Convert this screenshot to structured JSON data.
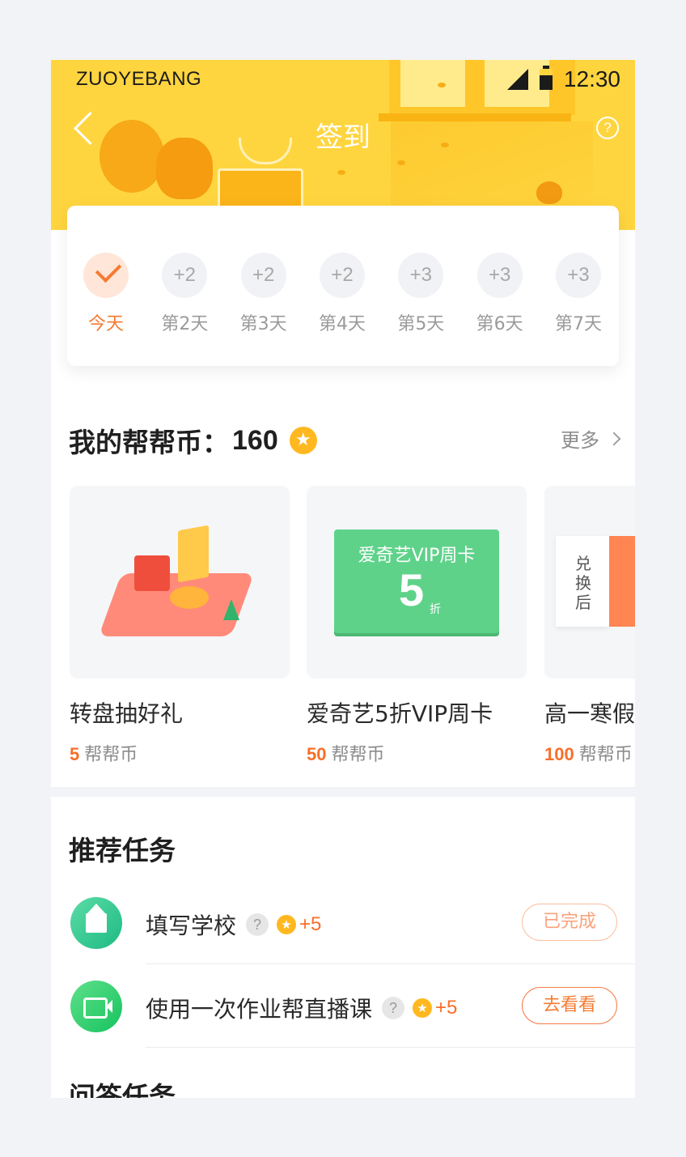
{
  "status_bar": {
    "carrier": "ZUOYEBANG",
    "time": "12:30"
  },
  "nav": {
    "title": "签到"
  },
  "signin": {
    "days": [
      {
        "circle": "",
        "label": "今天",
        "checked": true
      },
      {
        "circle": "+2",
        "label": "第2天"
      },
      {
        "circle": "+2",
        "label": "第3天"
      },
      {
        "circle": "+2",
        "label": "第4天"
      },
      {
        "circle": "+3",
        "label": "第5天"
      },
      {
        "circle": "+3",
        "label": "第6天"
      },
      {
        "circle": "+3",
        "label": "第7天"
      }
    ]
  },
  "coins": {
    "label": "我的帮帮币：",
    "amount": "160",
    "more": "更多"
  },
  "rewards": [
    {
      "name": "转盘抽好礼",
      "price": "5",
      "unit": "帮帮币"
    },
    {
      "name": "爱奇艺5折VIP周卡",
      "price": "50",
      "unit": "帮帮币",
      "card_title": "爱奇艺VIP周卡",
      "card_discount": "5",
      "card_unit": "折"
    },
    {
      "name": "高一寒假",
      "price": "100",
      "unit": "帮帮币",
      "coupon_text": "兑换后"
    }
  ],
  "tasks": {
    "title": "推荐任务",
    "items": [
      {
        "name": "填写学校",
        "reward": "+5",
        "button": "已完成",
        "icon": "school-icon"
      },
      {
        "name": "使用一次作业帮直播课",
        "reward": "+5",
        "button": "去看看",
        "icon": "video-icon"
      }
    ]
  },
  "qa": {
    "title": "问答任务"
  },
  "colors": {
    "header": "#ffd53f",
    "accent": "#f57b32",
    "coin": "#ffb81f"
  }
}
